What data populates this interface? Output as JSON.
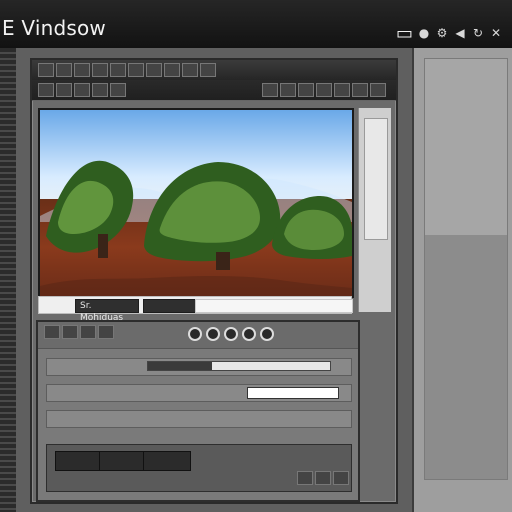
{
  "app": {
    "title": "E Vindsow",
    "top_icons": [
      {
        "name": "document-icon",
        "glyph": "▭"
      },
      {
        "name": "circle-icon",
        "glyph": "●"
      },
      {
        "name": "settings-icon",
        "glyph": "⚙"
      },
      {
        "name": "back-icon",
        "glyph": "◀"
      },
      {
        "name": "refresh-icon",
        "glyph": "↻"
      },
      {
        "name": "close-icon",
        "glyph": "✕"
      }
    ]
  },
  "window": {
    "title_left": "",
    "toolbar": {
      "labels": [
        "",
        "",
        ""
      ],
      "buttons": [
        "",
        "",
        "",
        "",
        "",
        "",
        "",
        "",
        ""
      ]
    },
    "viewport": {
      "description_alt": "",
      "colors": {
        "sky_top": "#6aa8e8",
        "sky_bottom": "#f2f2f2",
        "ground": "#8a3a1c",
        "tree_green": "#2f5e1f",
        "tree_highlight": "#7db24e"
      }
    },
    "status": {
      "left_label": "Sr. Mohiduas",
      "mid_label": "",
      "right_label": ""
    }
  },
  "lower": {
    "header": {
      "icons": [
        "play-icon",
        "pause-icon",
        "stop-icon",
        "record-icon",
        "loop-icon"
      ]
    },
    "rows": [
      {
        "label": "",
        "type": "progress",
        "value": 0.35
      },
      {
        "label": "",
        "type": "input",
        "value": ""
      },
      {
        "label": "",
        "type": "text",
        "value": ""
      }
    ],
    "tabs": [
      {
        "label": ""
      },
      {
        "label": ""
      },
      {
        "label": ""
      }
    ]
  }
}
